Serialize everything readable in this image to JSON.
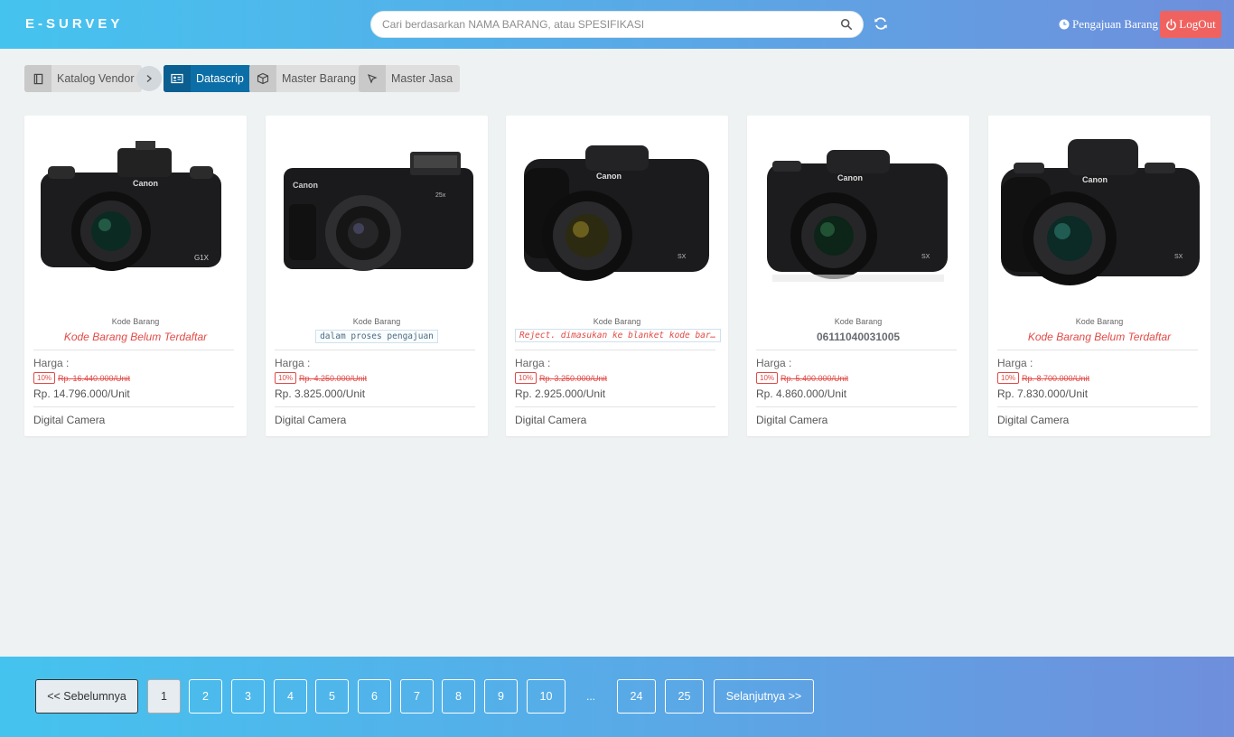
{
  "header": {
    "brand": "E-SURVEY",
    "search_placeholder": "Cari berdasarkan NAMA BARANG, atau SPESIFIKASI",
    "pengajuan_label": "Pengajuan Barang",
    "logout_label": "LogOut"
  },
  "breadcrumb": {
    "katalog": "Katalog Vendor",
    "datascrip": "Datascrip",
    "master_barang": "Master Barang",
    "master_jasa": "Master Jasa"
  },
  "products": [
    {
      "kode_label": "Kode Barang",
      "kode_value": "Kode Barang Belum Terdaftar",
      "harga_label": "Harga :",
      "discount": "10%",
      "old_price": "Rp. 16.440.000/Unit",
      "new_price": "Rp. 14.796.000/Unit",
      "category": "Digital Camera"
    },
    {
      "kode_label": "Kode Barang",
      "kode_value": "dalam proses pengajuan",
      "harga_label": "Harga :",
      "discount": "10%",
      "old_price": "Rp. 4.250.000/Unit",
      "new_price": "Rp. 3.825.000/Unit",
      "category": "Digital Camera"
    },
    {
      "kode_label": "Kode Barang",
      "kode_value": "Reject. dimasukan ke blanket kode bar…",
      "harga_label": "Harga :",
      "discount": "10%",
      "old_price": "Rp. 3.250.000/Unit",
      "new_price": "Rp. 2.925.000/Unit",
      "category": "Digital Camera"
    },
    {
      "kode_label": "Kode Barang",
      "kode_value": "06111040031005",
      "harga_label": "Harga :",
      "discount": "10%",
      "old_price": "Rp. 5.400.000/Unit",
      "new_price": "Rp. 4.860.000/Unit",
      "category": "Digital Camera"
    },
    {
      "kode_label": "Kode Barang",
      "kode_value": "Kode Barang Belum Terdaftar",
      "harga_label": "Harga :",
      "discount": "10%",
      "old_price": "Rp. 8.700.000/Unit",
      "new_price": "Rp. 7.830.000/Unit",
      "category": "Digital Camera"
    }
  ],
  "pagination": {
    "prev": "<< Sebelumnya",
    "pages": [
      "1",
      "2",
      "3",
      "4",
      "5",
      "6",
      "7",
      "8",
      "9",
      "10"
    ],
    "ellipsis": "...",
    "last_pages": [
      "24",
      "25"
    ],
    "next": "Selanjutnya >>",
    "current_page": "1"
  },
  "colors": {
    "accent": "#0c6ea7",
    "logout": "#f0625f",
    "alert": "#e14b47"
  },
  "icons": [
    "search-icon",
    "refresh-icon",
    "clock-icon",
    "power-icon",
    "book-icon",
    "chevron-right-icon",
    "id-card-icon",
    "box-icon",
    "cursor-icon"
  ]
}
